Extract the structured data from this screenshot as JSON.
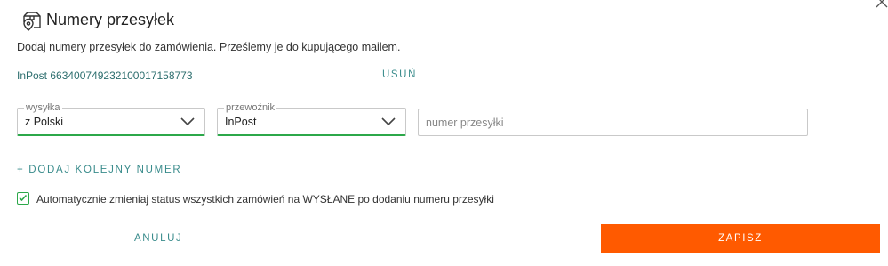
{
  "dialog": {
    "title": "Numery przesyłek",
    "icon": "package-pin-icon",
    "close_icon": "close-icon",
    "description": "Dodaj numery przesyłek do zamówienia. Prześlemy je do kupującego mailem."
  },
  "existing_shipment": {
    "number": "InPost 663400749232100017158773",
    "remove_label": "USUŃ"
  },
  "form": {
    "shipping": {
      "legend": "wysyłka",
      "value": "z Polski"
    },
    "carrier": {
      "legend": "przewoźnik",
      "value": "InPost"
    },
    "tracking": {
      "placeholder": "numer przesyłki",
      "value": ""
    },
    "add_another_label": "+ DODAJ KOLEJNY NUMER",
    "auto_status": {
      "checked": true,
      "label": "Automatycznie zmieniaj status wszystkich zamówień na WYSŁANE po dodaniu numeru przesyłki"
    }
  },
  "actions": {
    "cancel_label": "ANULUJ",
    "save_label": "ZAPISZ"
  },
  "colors": {
    "accent_teal": "#3a8c8c",
    "accent_green": "#2ca84a",
    "primary_orange": "#ff5a00"
  }
}
